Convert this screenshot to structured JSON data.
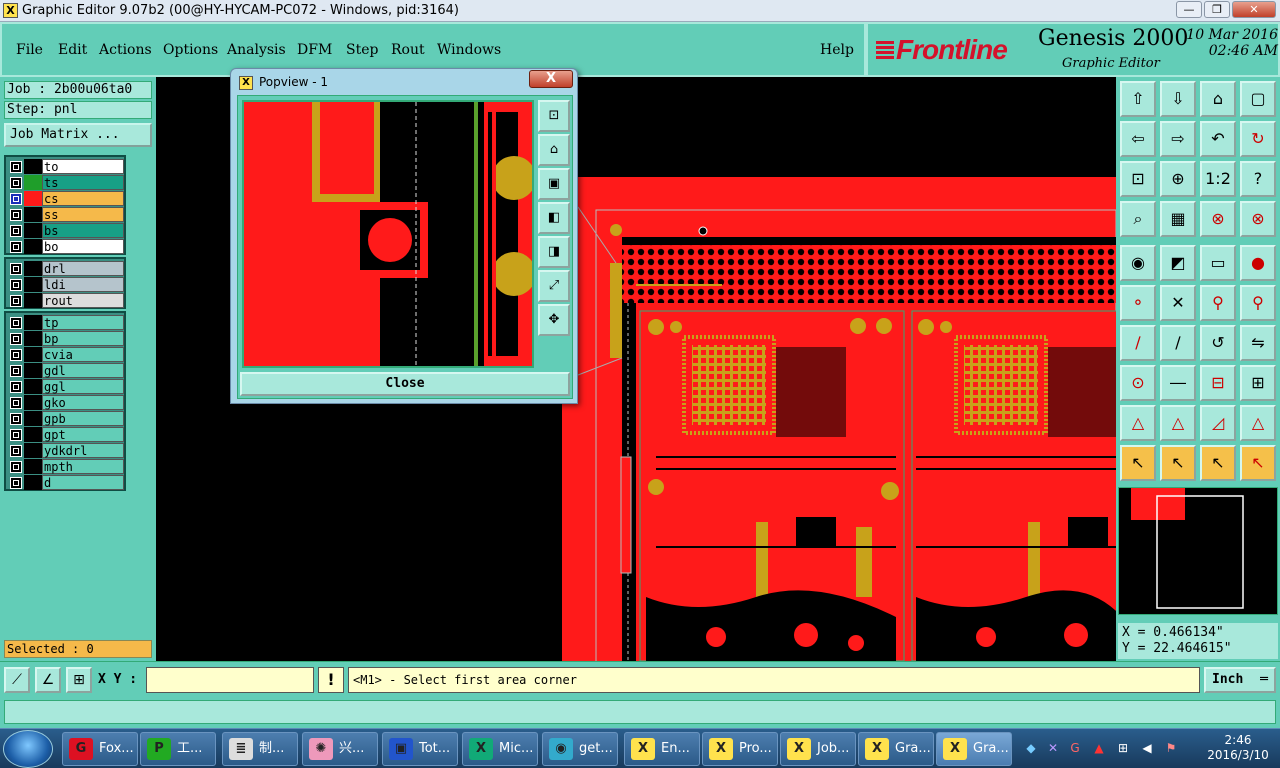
{
  "window": {
    "title": "Graphic Editor 9.07b2 (00@HY-HYCAM-PC072 - Windows, pid:3164)",
    "icon": "x-app-icon",
    "controls": [
      "—",
      "❐",
      "✕"
    ]
  },
  "menu": {
    "items": [
      "File",
      "Edit",
      "Actions",
      "Options",
      "Analysis",
      "DFM",
      "Step",
      "Rout",
      "Windows"
    ],
    "help": "Help"
  },
  "brand": {
    "logo": "Frontline",
    "product": "Genesis 2000",
    "subtitle": "Graphic Editor",
    "date": "10 Mar 2016",
    "time": "02:46 AM"
  },
  "left_panel": {
    "job": "Job : 2b00u06ta0",
    "step": "Step: pnl",
    "job_matrix": "Job Matrix ...",
    "layers_board": [
      {
        "name": "to",
        "color": "#ffffff",
        "swatch": "#000000",
        "checked": false
      },
      {
        "name": "ts",
        "color": "#17a086",
        "swatch": "#1f9e2a",
        "checked": false
      },
      {
        "name": "cs",
        "color": "#f5b94a",
        "swatch": "#ff1a1a",
        "checked": true
      },
      {
        "name": "ss",
        "color": "#f5b94a",
        "swatch": "#000000",
        "checked": false
      },
      {
        "name": "bs",
        "color": "#17a086",
        "swatch": "#000000",
        "checked": false
      },
      {
        "name": "bo",
        "color": "#ffffff",
        "swatch": "#000000",
        "checked": false
      }
    ],
    "layers_drill": [
      {
        "name": "drl",
        "color": "#b5c4cc",
        "swatch": "#000000"
      },
      {
        "name": "ldi",
        "color": "#b5c4cc",
        "swatch": "#000000"
      },
      {
        "name": "rout",
        "color": "#dddddd",
        "swatch": "#000000"
      }
    ],
    "layers_misc": [
      {
        "name": "tp"
      },
      {
        "name": "bp"
      },
      {
        "name": "cvia"
      },
      {
        "name": "gdl"
      },
      {
        "name": "ggl"
      },
      {
        "name": "gko"
      },
      {
        "name": "gpb"
      },
      {
        "name": "gpt"
      },
      {
        "name": "ydkdrl"
      },
      {
        "name": "mpth"
      },
      {
        "name": "d"
      }
    ],
    "selected": "Selected : 0"
  },
  "popview": {
    "title": "Popview - 1",
    "close_x": "X",
    "close_button": "Close",
    "side_buttons": [
      "fit-icon",
      "zoom-home-icon",
      "zoom-in-icon",
      "pan-left-icon",
      "pan-right-icon",
      "zoom-out-icon",
      "center-icon"
    ]
  },
  "tools": {
    "buttons": [
      "view-home-icon",
      "view-down-icon",
      "home-icon",
      "frame-icon",
      "pan-left-icon",
      "pan-right-icon",
      "step-back-icon",
      "redraw-icon",
      "fit-all-icon",
      "zoom-center-icon",
      "scale-1-2-icon",
      "help-icon",
      "measure-icon",
      "grid-icon",
      "snap-pad-icon",
      "snap-net-icon",
      "select-icon",
      "draw-line-icon",
      "ruler-icon",
      "pad-icon",
      "net-icon",
      "cross-icon",
      "connect-icon",
      "connect2-icon",
      "line-red-icon",
      "line-blue-icon",
      "arc-icon",
      "split-icon",
      "add-pad-icon",
      "line-icon",
      "mirror-icon",
      "group-icon",
      "triangle-icon",
      "arrow-triangle-icon",
      "polygon-icon",
      "slant-icon",
      "pointer-icon",
      "pointer-box-icon",
      "pointer-lasso-icon",
      "pointer-net-icon"
    ],
    "labels": {
      "scale": "1:2",
      "help": "?"
    }
  },
  "coords": {
    "x": "X = 0.466134\"",
    "y": "Y = 22.464615\""
  },
  "bottom": {
    "xy_label": "X Y :",
    "xy_value": "",
    "bang": "!",
    "prompt": "<M1> - Select first area corner",
    "unit": "Inch"
  },
  "taskbar": {
    "items": [
      {
        "label": "Fox...",
        "icon": "foxit-icon",
        "glyph": "G"
      },
      {
        "label": "工...",
        "icon": "pf-icon",
        "glyph": "P"
      },
      {
        "label": "制...",
        "icon": "notepad-icon",
        "glyph": "≣"
      },
      {
        "label": "兴...",
        "icon": "shell-icon",
        "glyph": "✺"
      },
      {
        "label": "Tot...",
        "icon": "floppy-icon",
        "glyph": "▣"
      },
      {
        "label": "Mic...",
        "icon": "excel-icon",
        "glyph": "X"
      },
      {
        "label": "get...",
        "icon": "eye-icon",
        "glyph": "◉"
      },
      {
        "label": "En...",
        "icon": "genesis-icon",
        "glyph": "X"
      },
      {
        "label": "Pro...",
        "icon": "genesis-icon",
        "glyph": "X"
      },
      {
        "label": "Job...",
        "icon": "genesis-icon",
        "glyph": "X"
      },
      {
        "label": "Gra...",
        "icon": "genesis-icon",
        "glyph": "X"
      },
      {
        "label": "Gra...",
        "icon": "genesis-icon",
        "glyph": "X"
      }
    ],
    "time": "2:46",
    "date": "2016/3/10"
  },
  "colors": {
    "panel": "#62cdb7",
    "copper": "#ff1a1a",
    "pad": "#c8a21a",
    "accent": "#f5b94a"
  }
}
